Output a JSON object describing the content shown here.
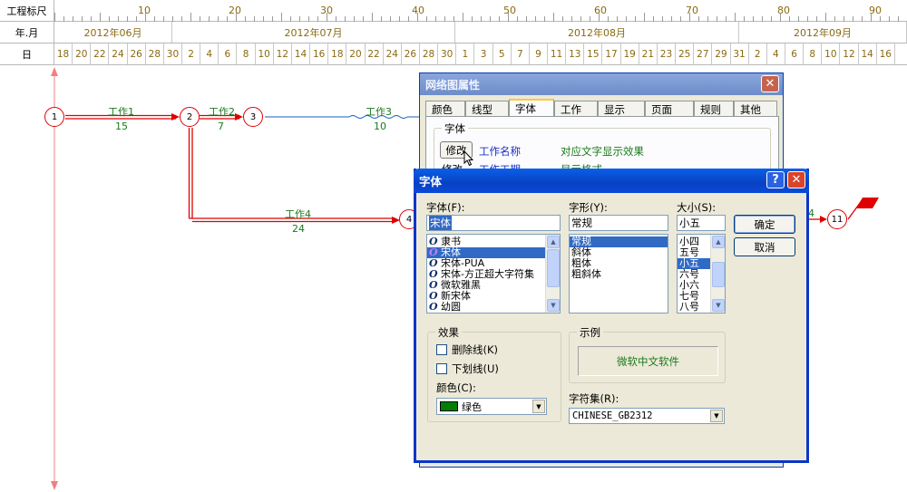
{
  "ruler": {
    "row1_label": "工程标尺",
    "row2_label": "年.月",
    "row3_label": "日",
    "scale_numbers": [
      "10",
      "20",
      "30",
      "40",
      "50",
      "60",
      "70",
      "80",
      "90"
    ],
    "months": [
      "2012年06月",
      "2012年07月",
      "2012年08月",
      "2012年09月"
    ],
    "days": [
      "18",
      "20",
      "22",
      "24",
      "26",
      "28",
      "30",
      "2",
      "4",
      "6",
      "8",
      "10",
      "12",
      "14",
      "16",
      "18",
      "20",
      "22",
      "24",
      "26",
      "28",
      "30",
      "1",
      "3",
      "5",
      "7",
      "9",
      "11",
      "13",
      "15",
      "17",
      "19",
      "21",
      "23",
      "25",
      "27",
      "29",
      "31",
      "2",
      "4",
      "6",
      "8",
      "10",
      "12",
      "14",
      "16"
    ]
  },
  "network": {
    "nodes": [
      "1",
      "2",
      "3",
      "4",
      "11"
    ],
    "tasks": [
      {
        "name": "工作1",
        "duration": "15"
      },
      {
        "name": "工作2",
        "duration": "7"
      },
      {
        "name": "工作3",
        "duration": "10"
      },
      {
        "name": "工作4",
        "duration": "24"
      }
    ],
    "partial_label": "4",
    "colors": {
      "critical": "#e00000",
      "normal": "#1060c0",
      "text": "#1a7a1a"
    }
  },
  "props_dialog": {
    "title": "网络图属性",
    "close_symbol": "✕",
    "tabs": [
      "颜色",
      "线型",
      "字体",
      "工作",
      "显示",
      "页面",
      "规则",
      "其他"
    ],
    "active_tab": "字体",
    "group_label": "字体",
    "modify_button": "修改",
    "field_name": "工作名称",
    "field_desc": "对应文字显示效果",
    "row2_partial_left": "修改",
    "row2_partial_mid": "工作工期",
    "row2_partial_right": "显示格式"
  },
  "font_dialog": {
    "title": "字体",
    "help_symbol": "?",
    "close_symbol": "✕",
    "font_label": "字体(F):",
    "font_value": "宋体",
    "font_list": [
      "隶书",
      "宋体",
      "宋体-PUA",
      "宋体-方正超大字符集",
      "微软雅黑",
      "新宋体",
      "幼圆"
    ],
    "font_selected": "宋体",
    "style_label": "字形(Y):",
    "style_value": "常规",
    "style_list": [
      "常规",
      "斜体",
      "粗体",
      "粗斜体"
    ],
    "style_selected": "常规",
    "size_label": "大小(S):",
    "size_value": "小五",
    "size_list": [
      "小四",
      "五号",
      "小五",
      "六号",
      "小六",
      "七号",
      "八号"
    ],
    "size_selected": "小五",
    "ok_button": "确定",
    "cancel_button": "取消",
    "effects_label": "效果",
    "strike_label": "删除线(K)",
    "underline_label": "下划线(U)",
    "color_label": "颜色(C):",
    "color_value": "绿色",
    "color_swatch": "#008000",
    "sample_label": "示例",
    "sample_text": "微软中文软件",
    "charset_label": "字符集(R):",
    "charset_value": "CHINESE_GB2312"
  }
}
